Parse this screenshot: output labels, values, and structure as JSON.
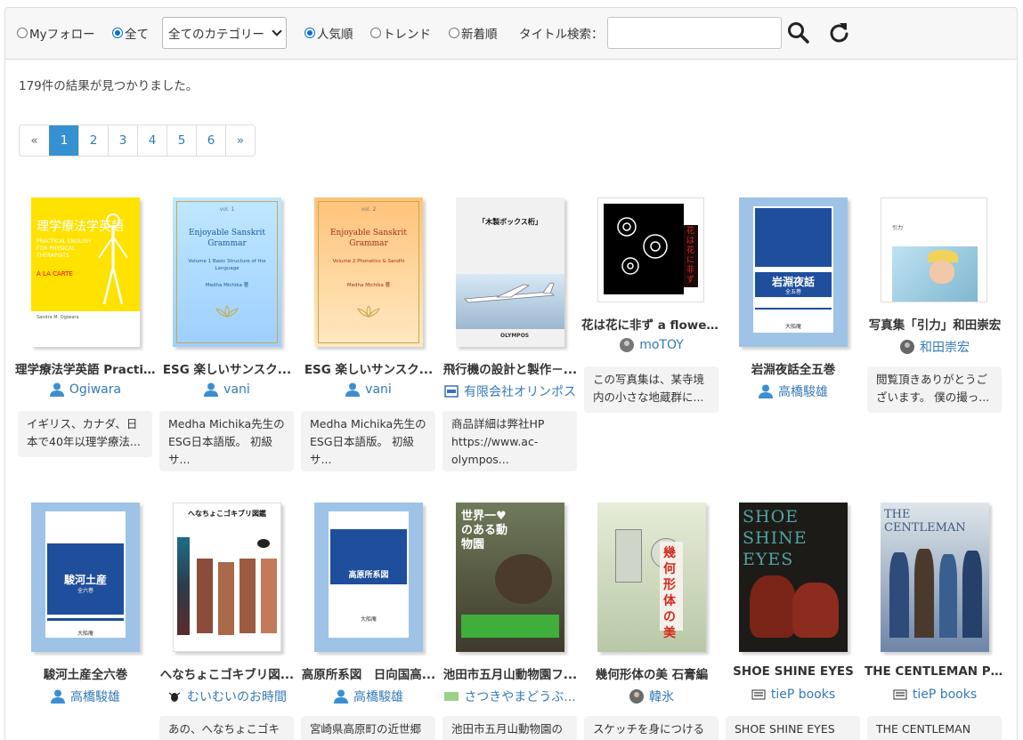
{
  "filters": {
    "my_follow": "Myフォロー",
    "all": "全て",
    "category": "全てのカテゴリー",
    "popular": "人気順",
    "trend": "トレンド",
    "newest": "新着順",
    "title_search_label": "タイトル検索：",
    "title_search_value": ""
  },
  "results": {
    "count_text": "179件の結果が見つかりました。"
  },
  "pagination": [
    "«",
    "1",
    "2",
    "3",
    "4",
    "5",
    "6",
    "»"
  ],
  "books": [
    {
      "title": "理学療法学英語 Practi...",
      "author": "Ogiwara",
      "desc": "イギリス、カナダ、日本で40年以理学療法...",
      "cover": {
        "title": "理学療法学英語",
        "sub": "PRACTICAL ENGLISH FOR PHYSICAL THERAPISTS",
        "tag": "À LA CARTE",
        "foot": "Sandra M. Ogiwara"
      }
    },
    {
      "title": "ESG 楽しいサンスク...",
      "author": "vani",
      "desc": "Medha Michika先生のESG日本語版。 初級サ...",
      "cover": {
        "vol": "vol. 1",
        "title": "Enjoyable Sanskrit Grammar",
        "sub": "Volume 1 Basic Structure of the Language",
        "auth": "Medha Michika 著"
      }
    },
    {
      "title": "ESG 楽しいサンスク...",
      "author": "vani",
      "desc": "Medha Michika先生のESG日本語版。 初級サ...",
      "cover": {
        "vol": "vol. 2",
        "title": "Enjoyable Sanskrit Grammar",
        "sub": "Volume 2 Phonetics & Sandhi",
        "auth": "Medha Michika 著"
      }
    },
    {
      "title": "飛行機の設計と製作－...",
      "author": "有限会社オリンポス",
      "desc": "商品詳細は弊社HP https://www.ac-olympos...",
      "cover": {
        "title": "「木製ボックス桁」",
        "foot": "OLYMPOS"
      }
    },
    {
      "title": "花は花に非ず a flower...",
      "author": "moTOY",
      "desc": "この写真集は、某寺境内の小さな地蔵群に...",
      "cover": {
        "title": "花は花に非ず"
      }
    },
    {
      "title": "岩淵夜話全五巻",
      "author": "高橋駿雄",
      "desc": "",
      "cover": {
        "title": "岩淵夜話",
        "sub": "全五巻",
        "foot": "大船庵"
      }
    },
    {
      "title": "写真集「引力」和田崇宏",
      "author": "和田崇宏",
      "desc": "閲覧頂きありがとうございます。 僕の撮っ...",
      "cover": {
        "title": "引力"
      }
    },
    {
      "title": "駿河土産全六巻",
      "author": "高橋駿雄",
      "desc": "",
      "cover": {
        "title": "駿河土産",
        "sub": "全六巻",
        "foot": "大船庵"
      }
    },
    {
      "title": "へなちょこゴキブリ図...",
      "author": "むいむいのお時間",
      "desc": "あの、へなちょこゴキ",
      "cover": {
        "title": "へなちょこゴキブリ図鑑"
      }
    },
    {
      "title": "高原所系図　日向国高...",
      "author": "高橋駿雄",
      "desc": "宮崎県高原町の近世郷",
      "cover": {
        "title": "高原所系図",
        "foot": "大船庵"
      }
    },
    {
      "title": "池田市五月山動物園フ...",
      "author": "さつきやまどうぶ...",
      "desc": "池田市五月山動物園の",
      "cover": {
        "title": "世界一♥のある動物園"
      }
    },
    {
      "title": "幾何形体の美 石膏編",
      "author": "韓氷",
      "desc": "スケッチを身につける",
      "cover": {
        "title": "幾何形体の美"
      }
    },
    {
      "title": "SHOE SHINE EYES",
      "author": "tieP books",
      "desc": "SHOE SHINE EYES",
      "cover": {
        "title": "SHOE SHINE EYES"
      }
    },
    {
      "title": "THE CENTLEMAN PH...",
      "author": "tieP books",
      "desc": "THE CENTLEMAN",
      "cover": {
        "title": "THE CENTLEMAN"
      }
    }
  ],
  "colors": {
    "accent": "#3691d1",
    "link": "#337ab7",
    "radio": "#0b6fd6"
  }
}
